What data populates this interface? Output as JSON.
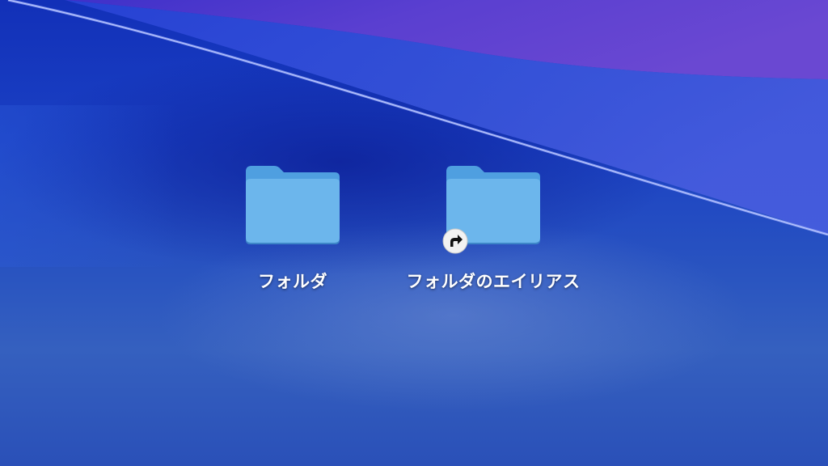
{
  "desktop": {
    "icons": [
      {
        "label": "フォルダ",
        "icon": "folder-icon"
      },
      {
        "label": "フォルダのエイリアス",
        "icon": "folder-icon",
        "badge": "alias-arrow-icon"
      }
    ]
  },
  "colors": {
    "folder_back": "#4f9fe0",
    "folder_front": "#6cb6ec",
    "wallpaper_deep": "#1230b8",
    "wallpaper_purple": "#6a4ad0",
    "label_text": "#ffffff"
  }
}
